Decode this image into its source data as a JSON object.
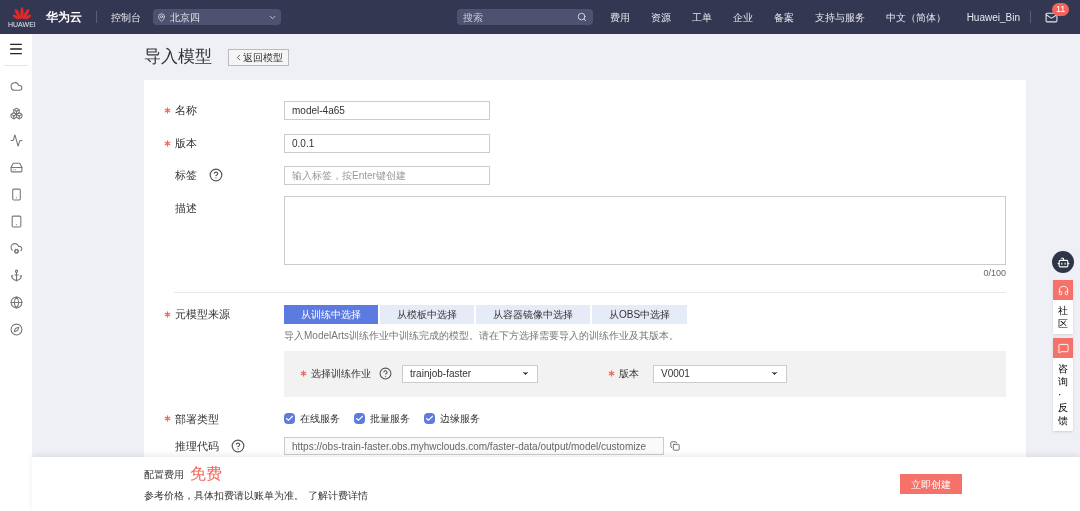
{
  "topbar": {
    "brand": "华为云",
    "logo_text": "HUAWEI",
    "console": "控制台",
    "region": "北京四",
    "search": {
      "placeholder": "搜索"
    },
    "nav": [
      "费用",
      "资源",
      "工单",
      "企业",
      "备案",
      "支持与服务",
      "中文（简体）",
      "Huawei_Bin"
    ],
    "mail_badge": "11"
  },
  "page": {
    "title": "导入模型",
    "back": "返回模型"
  },
  "form": {
    "name": {
      "label": "名称",
      "required": true,
      "value": "model-4a65"
    },
    "version": {
      "label": "版本",
      "required": true,
      "value": "0.0.1"
    },
    "tags": {
      "label": "标签",
      "required": false,
      "placeholder": "输入标签，按Enter键创建"
    },
    "description": {
      "label": "描述",
      "required": false,
      "counter": "0/100"
    },
    "source": {
      "label": "元模型来源",
      "required": true,
      "tabs": [
        {
          "label": "从训练中选择",
          "selected": true
        },
        {
          "label": "从模板中选择",
          "selected": false
        },
        {
          "label": "从容器镜像中选择",
          "selected": false
        },
        {
          "label": "从OBS中选择",
          "selected": false
        }
      ],
      "hint": "导入ModelArts训练作业中训练完成的模型。请在下方选择需要导入的训练作业及其版本。",
      "job": {
        "label": "选择训练作业",
        "value": "trainjob-faster"
      },
      "job_version": {
        "label": "版本",
        "value": "V0001"
      }
    },
    "deploy": {
      "label": "部署类型",
      "required": true,
      "options": [
        {
          "label": "在线服务",
          "checked": true
        },
        {
          "label": "批量服务",
          "checked": true
        },
        {
          "label": "边缘服务",
          "checked": true
        }
      ]
    },
    "code": {
      "label": "推理代码",
      "value": "https://obs-train-faster.obs.myhwclouds.com/faster-data/output/model/customize"
    }
  },
  "footer": {
    "fee_label": "配置费用",
    "fee": "免费",
    "note": "参考价格，具体扣费请以账单为准。",
    "link": "了解计费详情",
    "submit": "立即创建"
  },
  "float": {
    "community": "社区",
    "feedback": "咨询·反馈"
  }
}
